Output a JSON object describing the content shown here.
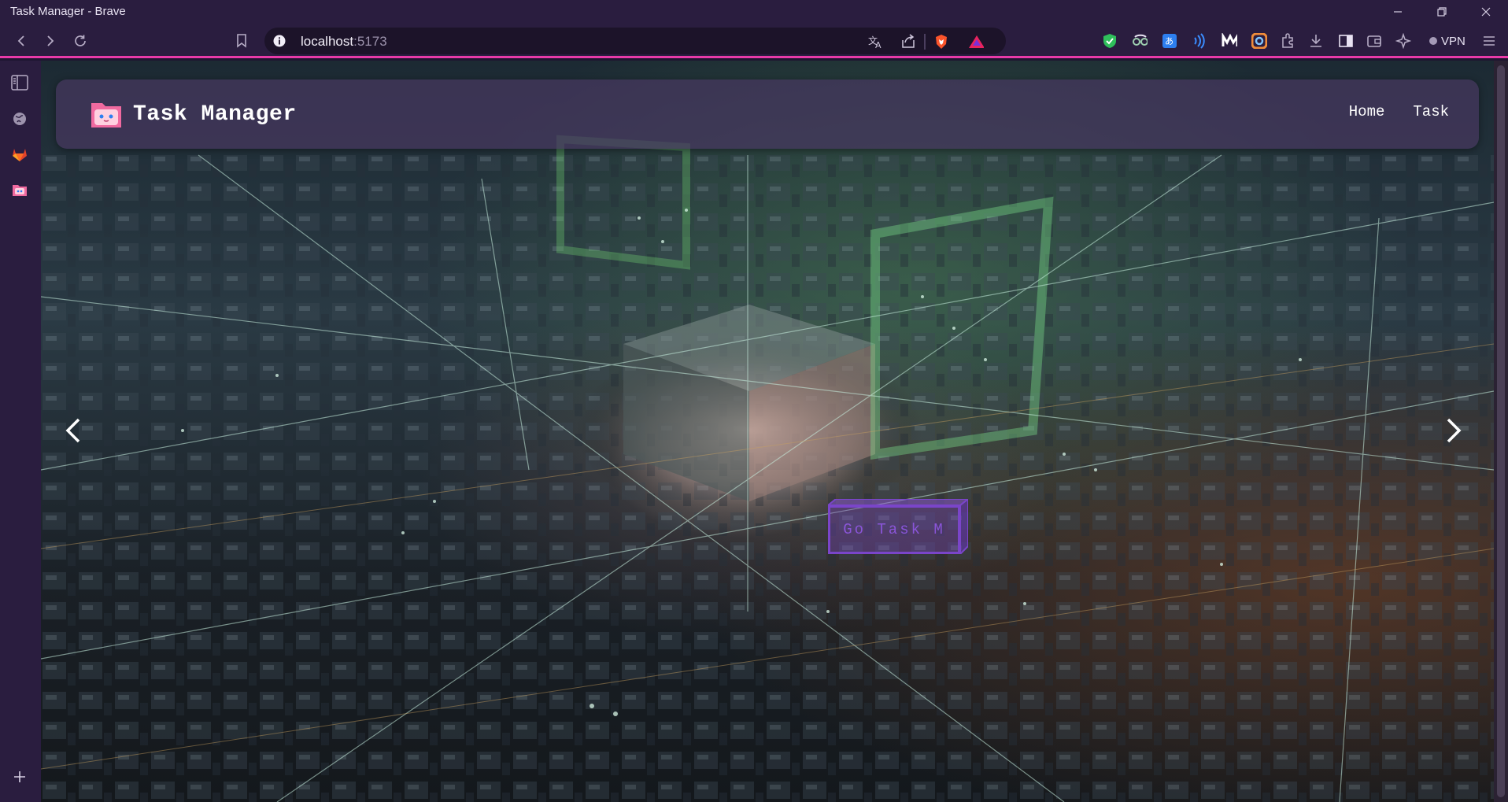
{
  "window": {
    "title": "Task Manager - Brave",
    "controls": [
      "minimize",
      "restore",
      "close"
    ]
  },
  "browser": {
    "url_host": "localhost",
    "url_port": ":5173",
    "vpn_label": "VPN",
    "accent": "#e83aa8"
  },
  "navbar": {
    "brand": "Task Manager",
    "links": [
      "Home",
      "Task"
    ]
  },
  "hero": {
    "cta_label": "Go Task M"
  }
}
